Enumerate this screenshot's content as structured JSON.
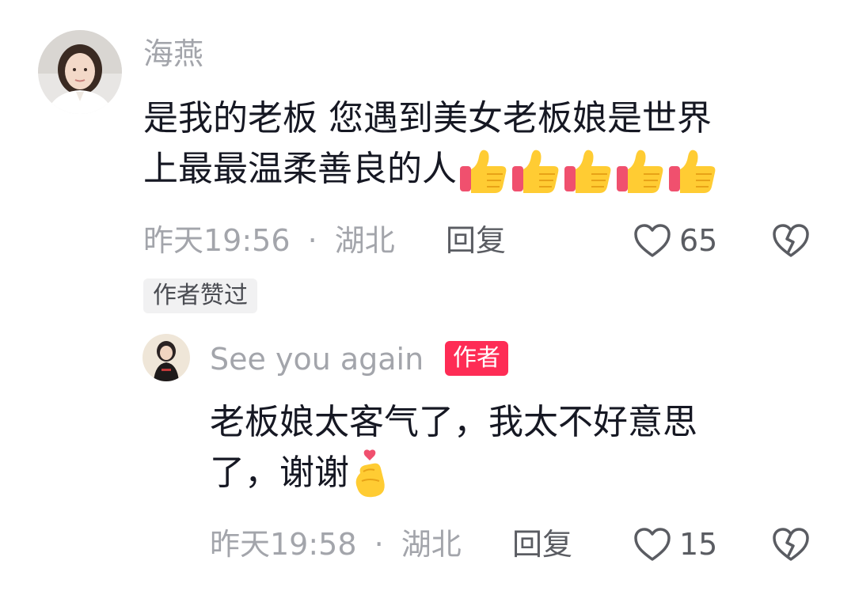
{
  "colors": {
    "username": "#a3a5ab",
    "text": "#161823",
    "meta": "#a3a5ab",
    "action": "#5a5c62",
    "author_tag_bg": "#fe2c55",
    "liked_badge_bg": "#f1f1f2"
  },
  "comment": {
    "username": "海燕",
    "avatar_icon": "woman-avatar",
    "text_line1": "是我的老板 您遇到美女老板娘是世界",
    "text_line2": "上最最温柔善良的人",
    "emojis": [
      "thumbs-up-icon",
      "thumbs-up-icon",
      "thumbs-up-icon",
      "thumbs-up-icon",
      "thumbs-up-icon"
    ],
    "time": "昨天19:56",
    "separator": "·",
    "location": "湖北",
    "reply_label": "回复",
    "like_count": "65",
    "author_liked_badge": "作者赞过"
  },
  "reply": {
    "username": "See you again",
    "author_tag": "作者",
    "avatar_icon": "child-avatar",
    "text_line1": "老板娘太客气了，我太不好意思",
    "text_line2": "了，谢谢",
    "emoji": "finger-heart-icon",
    "time": "昨天19:58",
    "separator": "·",
    "location": "湖北",
    "reply_label": "回复",
    "like_count": "15"
  }
}
